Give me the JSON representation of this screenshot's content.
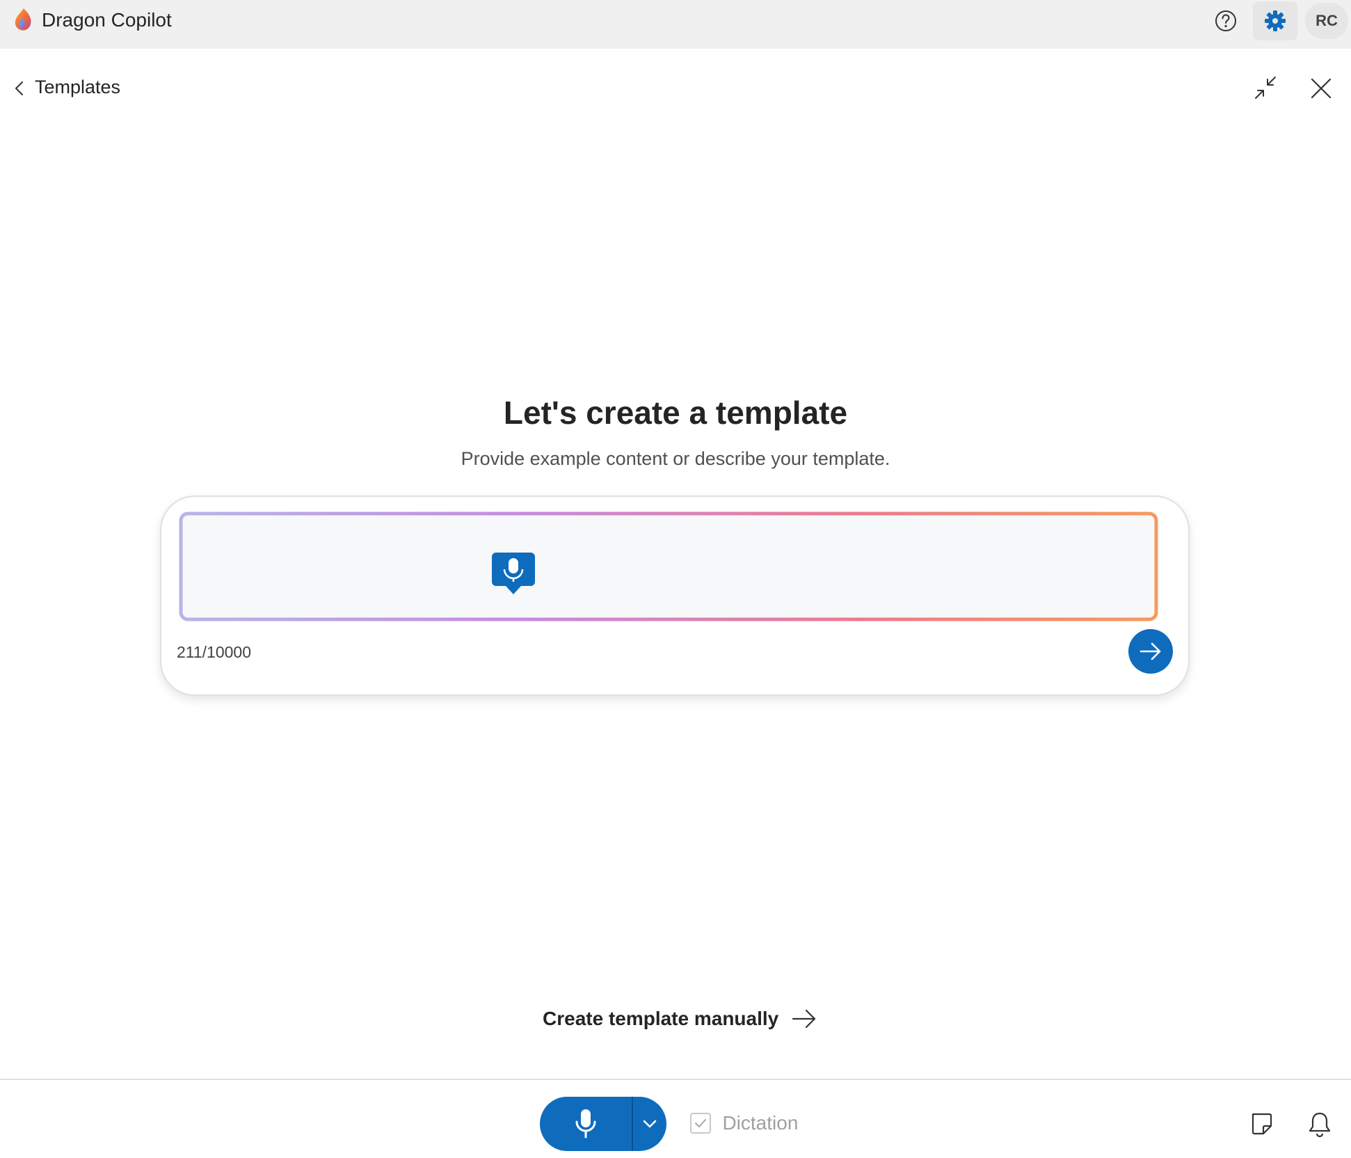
{
  "app": {
    "title": "Dragon Copilot",
    "user_initials": "RC",
    "icons": [
      "dragon-copilot-logo",
      "help-icon",
      "gear-icon"
    ],
    "colors": {
      "accent": "#0f6cbd",
      "titlebar_bg": "#f0f0f0"
    }
  },
  "header": {
    "back_icon": "chevron-left-icon",
    "title": "Templates",
    "actions": [
      "collapse-icon",
      "close-icon"
    ]
  },
  "main": {
    "title": "Let's create a template",
    "subtitle": "Provide example content or describe your template.",
    "input": {
      "char_count": "211/10000",
      "send_icon": "arrow-right-icon",
      "illustration_icon": "microphone-icon"
    },
    "manual_link": {
      "label": "Create template manually",
      "icon": "arrow-right-icon"
    }
  },
  "bottom_bar": {
    "mic_icon": "microphone-icon",
    "mic_dropdown_icon": "chevron-down-icon",
    "dictation": {
      "label": "Dictation",
      "checked": true
    },
    "note_icon": "sticky-note-icon",
    "bell_icon": "bell-icon"
  }
}
